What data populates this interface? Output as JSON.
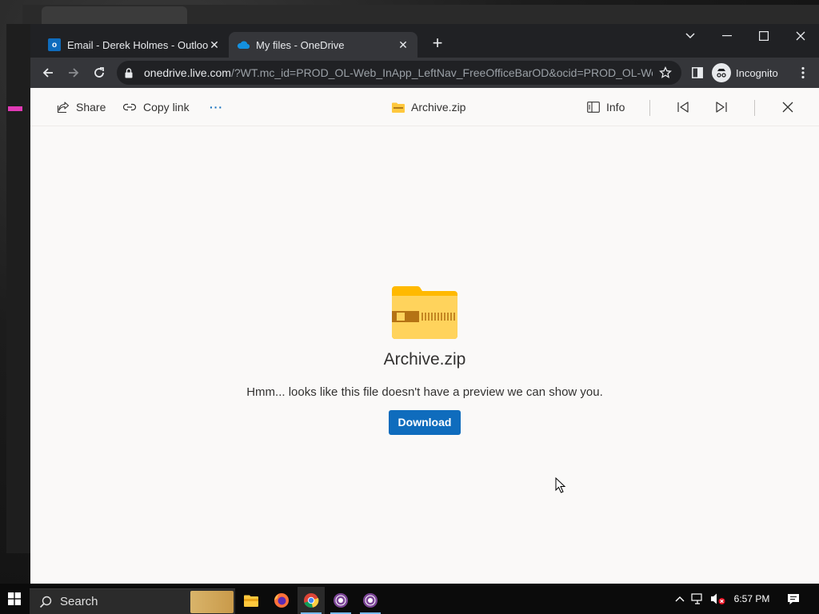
{
  "browser": {
    "tabs": [
      {
        "title": "Email - Derek Holmes - Outlook",
        "icon": "outlook-icon",
        "active": false
      },
      {
        "title": "My files - OneDrive",
        "icon": "onedrive-cloud-icon",
        "active": true
      }
    ],
    "url_host": "onedrive.live.com",
    "url_path": "/?WT.mc_id=PROD_OL-Web_InApp_LeftNav_FreeOfficeBarOD&ocid=PROD_OL-We...",
    "profile_label": "Incognito"
  },
  "viewer": {
    "share_label": "Share",
    "copy_link_label": "Copy link",
    "more_label": "···",
    "file_name": "Archive.zip",
    "info_label": "Info",
    "message": "Hmm... looks like this file doesn't have a preview we can show you.",
    "download_label": "Download"
  },
  "taskbar": {
    "search_placeholder": "Search",
    "time": "6:57 PM",
    "apps": [
      "file-explorer-icon",
      "firefox-icon",
      "chrome-icon",
      "tor-browser-icon",
      "tor-browser-icon"
    ]
  },
  "colors": {
    "accent": "#0f6cbd",
    "folder": "#ffc83d"
  }
}
